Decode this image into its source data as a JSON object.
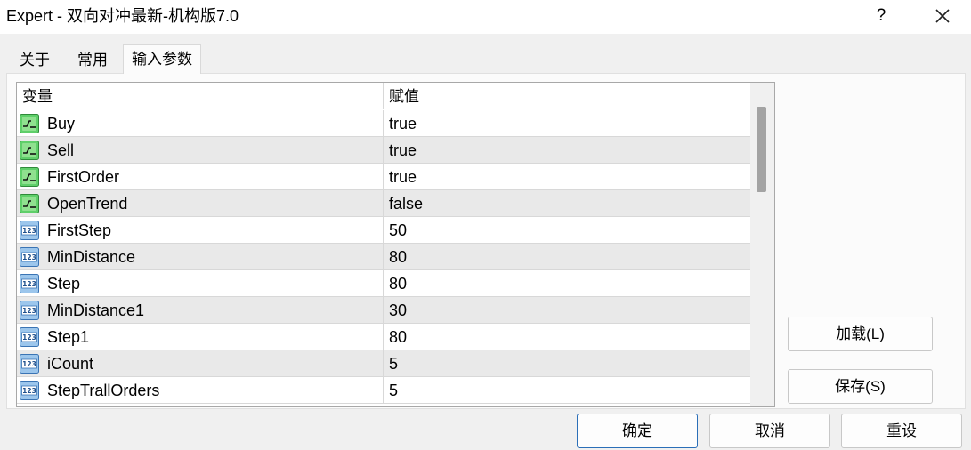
{
  "window": {
    "title": "Expert - 双向对冲最新-机构版7.0",
    "help_label": "?"
  },
  "tabs": [
    {
      "label": "关于"
    },
    {
      "label": "常用"
    },
    {
      "label": "输入参数"
    }
  ],
  "grid": {
    "headers": {
      "variable": "变量",
      "value": "赋值"
    },
    "rows": [
      {
        "type": "bool",
        "name": "Buy",
        "value": "true"
      },
      {
        "type": "bool",
        "name": "Sell",
        "value": "true"
      },
      {
        "type": "bool",
        "name": "FirstOrder",
        "value": "true"
      },
      {
        "type": "bool",
        "name": "OpenTrend",
        "value": "false"
      },
      {
        "type": "int",
        "name": "FirstStep",
        "value": "50"
      },
      {
        "type": "int",
        "name": "MinDistance",
        "value": "80"
      },
      {
        "type": "int",
        "name": "Step",
        "value": "80"
      },
      {
        "type": "int",
        "name": "MinDistance1",
        "value": "30"
      },
      {
        "type": "int",
        "name": "Step1",
        "value": "80"
      },
      {
        "type": "int",
        "name": "iCount",
        "value": "5"
      },
      {
        "type": "int",
        "name": "StepTrallOrders",
        "value": "5"
      }
    ]
  },
  "side_buttons": {
    "load": "加载(L)",
    "save": "保存(S)"
  },
  "footer_buttons": {
    "ok": "确定",
    "cancel": "取消",
    "reset": "重设"
  }
}
